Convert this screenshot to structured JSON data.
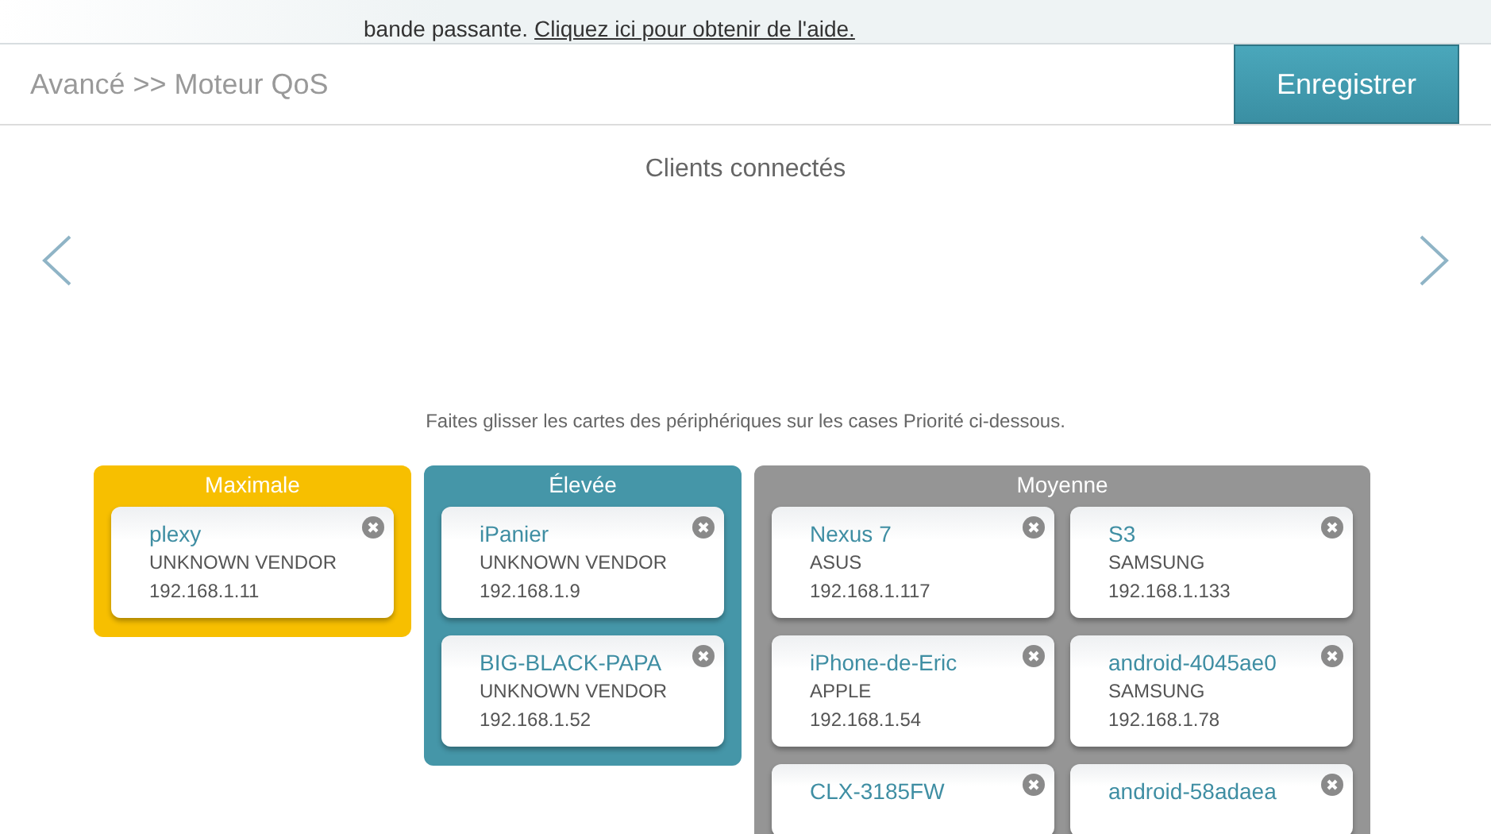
{
  "banner": {
    "text": "bande passante.",
    "link": "Cliquez ici pour obtenir de l'aide."
  },
  "header": {
    "breadcrumb": "Avancé >> Moteur QoS",
    "save_button": "Enregistrer"
  },
  "clients": {
    "title": "Clients connectés"
  },
  "instructions": "Faites glisser les cartes des périphériques sur les cases Priorité ci-dessous.",
  "groups": [
    {
      "title": "Maximale",
      "color": "#f7bf00",
      "devices": [
        {
          "name": "plexy",
          "vendor": "UNKNOWN VENDOR",
          "ip": "192.168.1.11"
        }
      ]
    },
    {
      "title": "Élevée",
      "color": "#4596a8",
      "devices": [
        {
          "name": "iPanier",
          "vendor": "UNKNOWN VENDOR",
          "ip": "192.168.1.9"
        },
        {
          "name": "BIG-BLACK-PAPA",
          "vendor": "UNKNOWN VENDOR",
          "ip": "192.168.1.52"
        }
      ]
    },
    {
      "title": "Moyenne",
      "color": "#959595",
      "devices": [
        {
          "name": "Nexus 7",
          "vendor": "ASUS",
          "ip": "192.168.1.117"
        },
        {
          "name": "S3",
          "vendor": "SAMSUNG",
          "ip": "192.168.1.133"
        },
        {
          "name": "iPhone-de-Eric",
          "vendor": "APPLE",
          "ip": "192.168.1.54"
        },
        {
          "name": "android-4045ae0",
          "vendor": "SAMSUNG",
          "ip": "192.168.1.78"
        },
        {
          "name": "CLX-3185FW"
        },
        {
          "name": "android-58adaea"
        }
      ]
    }
  ]
}
